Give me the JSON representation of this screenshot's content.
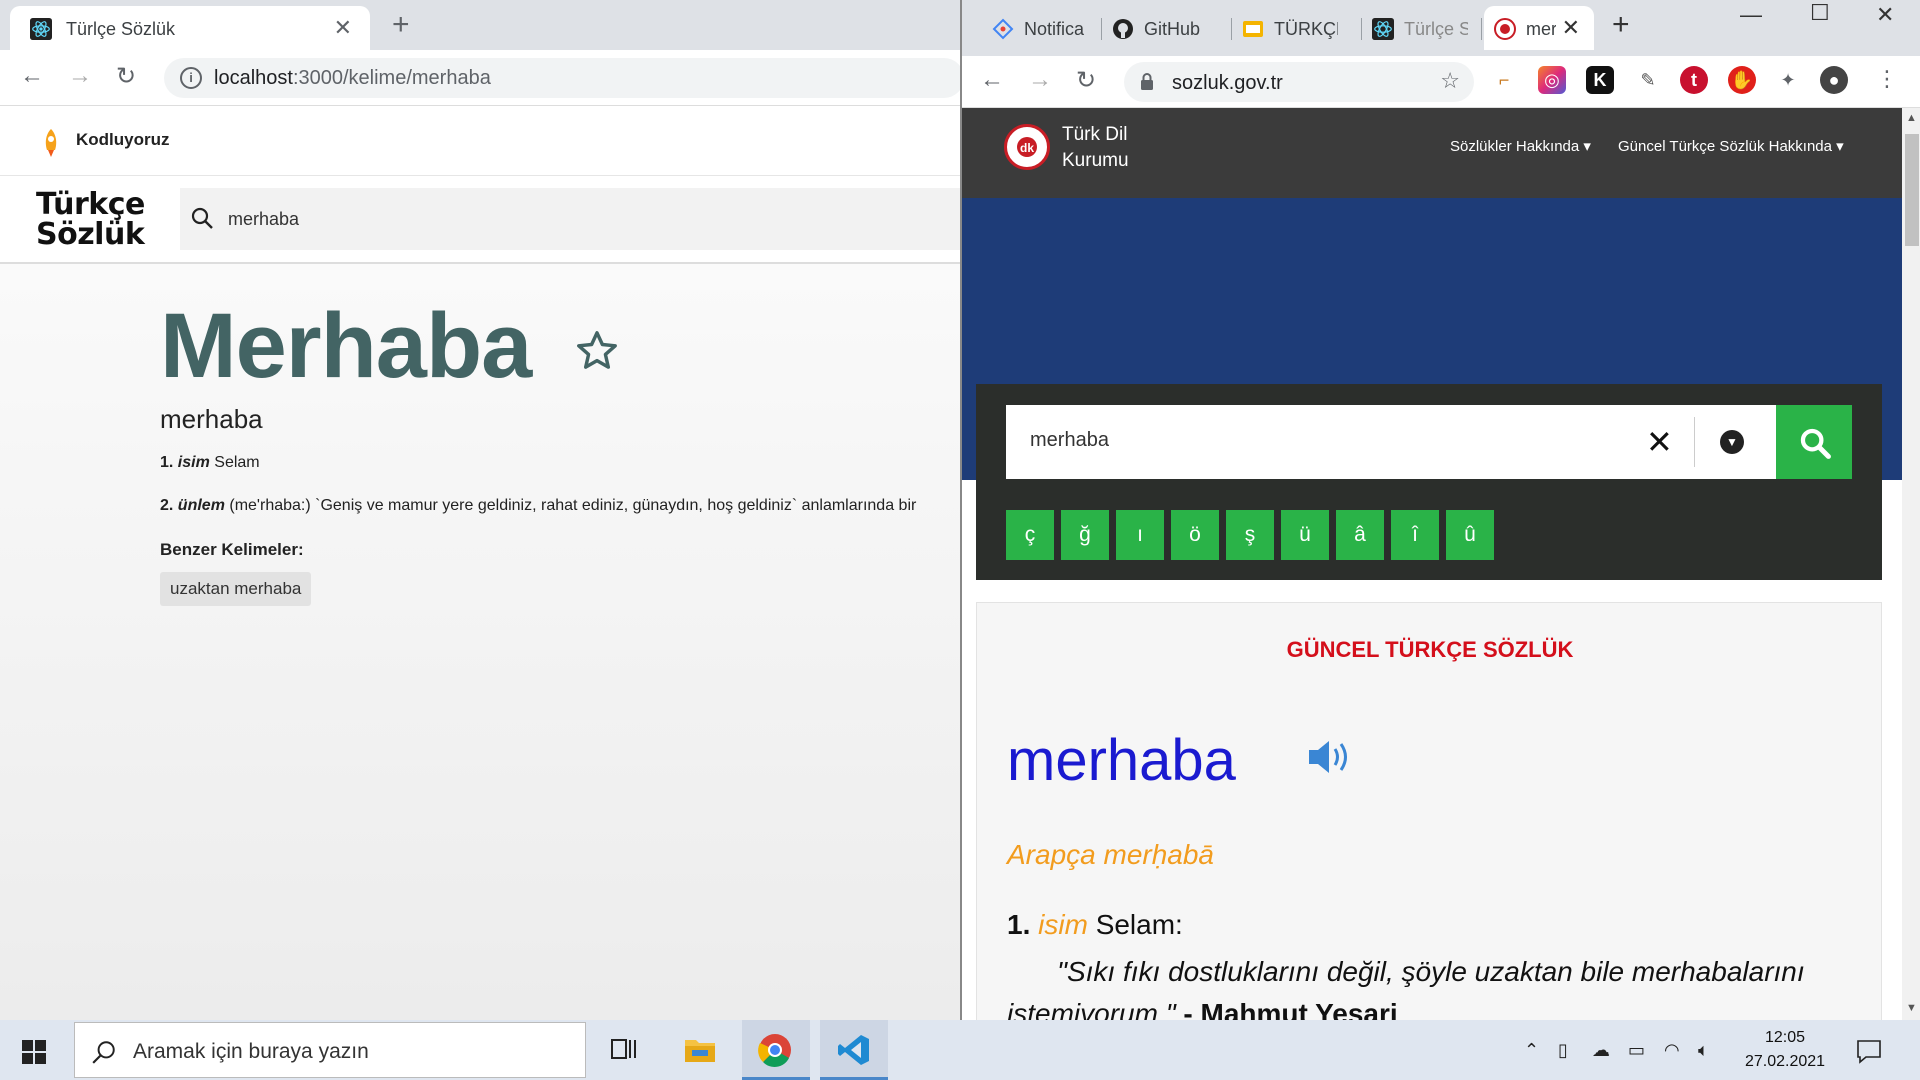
{
  "left_browser": {
    "tab_title": "Türlçe Sözlük",
    "url_host": "localhost",
    "url_path": ":3000/kelime/merhaba",
    "app": {
      "brand": "Kodluyoruz",
      "logo_line1": "Türkçe",
      "logo_line2": "Sözlük",
      "search_value": "merhaba",
      "word_title": "Merhaba",
      "word_sub": "merhaba",
      "definitions": [
        {
          "num": "1.",
          "cls": "isim",
          "text": "Selam"
        },
        {
          "num": "2.",
          "cls": "ünlem",
          "text": "(me'rhaba:) `Geniş ve mamur yere geldiniz, rahat ediniz, günaydın, hoş geldiniz` anlamlarında bir"
        }
      ],
      "similar_heading": "Benzer Kelimeler:",
      "similar": [
        "uzaktan merhaba"
      ]
    }
  },
  "right_browser": {
    "tabs": [
      "Notifica",
      "GitHub",
      "TÜRKÇE",
      "Türlçe S",
      "mer"
    ],
    "url": "sozluk.gov.tr",
    "site": {
      "logo_line1": "Türk Dil",
      "logo_line2": "Kurumu",
      "menu": [
        "Sözlükler Hakkında",
        "Güncel Türkçe Sözlük Hakkında"
      ],
      "search_value": "merhaba",
      "chars": [
        "ç",
        "ğ",
        "ı",
        "ö",
        "ş",
        "ü",
        "â",
        "î",
        "û"
      ],
      "dict_heading": "GÜNCEL TÜRKÇE SÖZLÜK",
      "word": "merhaba",
      "origin": "Arapça merḥabā",
      "meaning_num": "1.",
      "meaning_cls": "isim",
      "meaning_text": "Selam:",
      "quote": "\"Sıkı fıkı dostluklarını değil, şöyle uzaktan bile merhabalarını istemiyorum.\"",
      "quote_author": " - Mahmut Yesari"
    }
  },
  "taskbar": {
    "search_placeholder": "Aramak için buraya yazın",
    "time": "12:05",
    "date": "27.02.2021"
  },
  "colors": {
    "tdk_green": "#2ab348",
    "tdk_blue": "#1e3c78",
    "tdk_red": "#d40f1b",
    "word_blue": "#1a1ad0",
    "origin_orange": "#f29c1e",
    "app_title": "#436464"
  }
}
